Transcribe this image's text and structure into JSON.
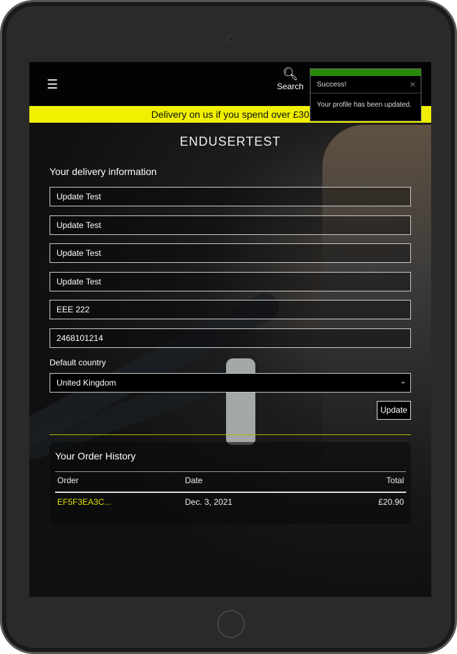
{
  "header": {
    "menu_icon": "hamburger-icon",
    "search_label": "Search",
    "search_icon": "search-icon"
  },
  "banner": {
    "text": "Delivery on us if you spend over £30"
  },
  "toast": {
    "title": "Success!",
    "message": "Your profile has been updated.",
    "accent": "#2a8a0a"
  },
  "page": {
    "title": "ENDUSERTEST",
    "delivery_heading": "Your delivery information",
    "fields": [
      "Update Test",
      "Update Test",
      "Update Test",
      "Update Test",
      "EEE 222",
      "2468101214"
    ],
    "country_label": "Default country",
    "country_value": "United Kingdom",
    "update_label": "Update"
  },
  "orders": {
    "heading": "Your Order History",
    "columns": [
      "Order",
      "Date",
      "Total"
    ],
    "rows": [
      {
        "order": "EF5F3EA3C...",
        "date": "Dec. 3, 2021",
        "total": "£20.90"
      }
    ]
  },
  "colors": {
    "banner": "#f0f000",
    "order_link": "#e0e000"
  }
}
